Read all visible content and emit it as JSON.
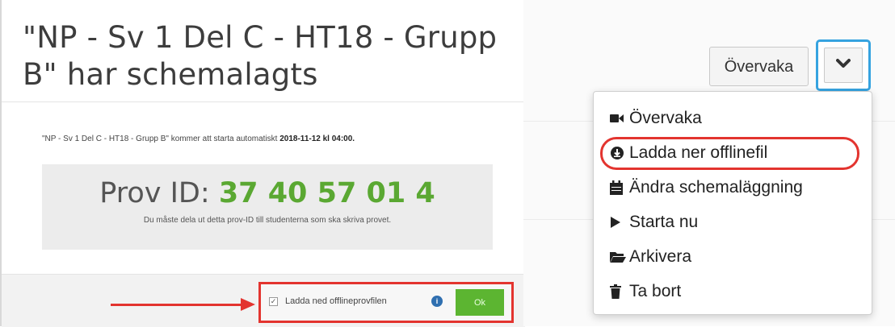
{
  "modal": {
    "title": "\"NP - Sv 1 Del C - HT18 - Grupp B\" har schemalagts",
    "note_prefix": "\"NP - Sv 1 Del C - HT18 - Grupp B\" kommer att starta automatiskt ",
    "note_datetime": "2018-11-12 kl 04:00.",
    "id_label": "Prov ID: ",
    "id_value": "37 40 57 01 4",
    "id_hint": "Du måste dela ut detta prov-ID till studenterna som ska skriva provet.",
    "checkbox_label": "Ladda ned offlineprovfilen",
    "ok_label": "Ok"
  },
  "toolbar": {
    "monitor_label": "Övervaka"
  },
  "menu": {
    "items": [
      {
        "label": "Övervaka",
        "icon": "video-camera-icon"
      },
      {
        "label": "Ladda ner offlinefil",
        "icon": "download-circle-icon"
      },
      {
        "label": "Ändra schemaläggning",
        "icon": "calendar-icon"
      },
      {
        "label": "Starta nu",
        "icon": "play-icon"
      },
      {
        "label": "Arkivera",
        "icon": "folder-open-icon"
      },
      {
        "label": "Ta bort",
        "icon": "trash-icon"
      }
    ]
  },
  "colors": {
    "accent_green": "#5aa832",
    "highlight_red": "#e3342f",
    "focus_blue": "#36a3e0"
  }
}
